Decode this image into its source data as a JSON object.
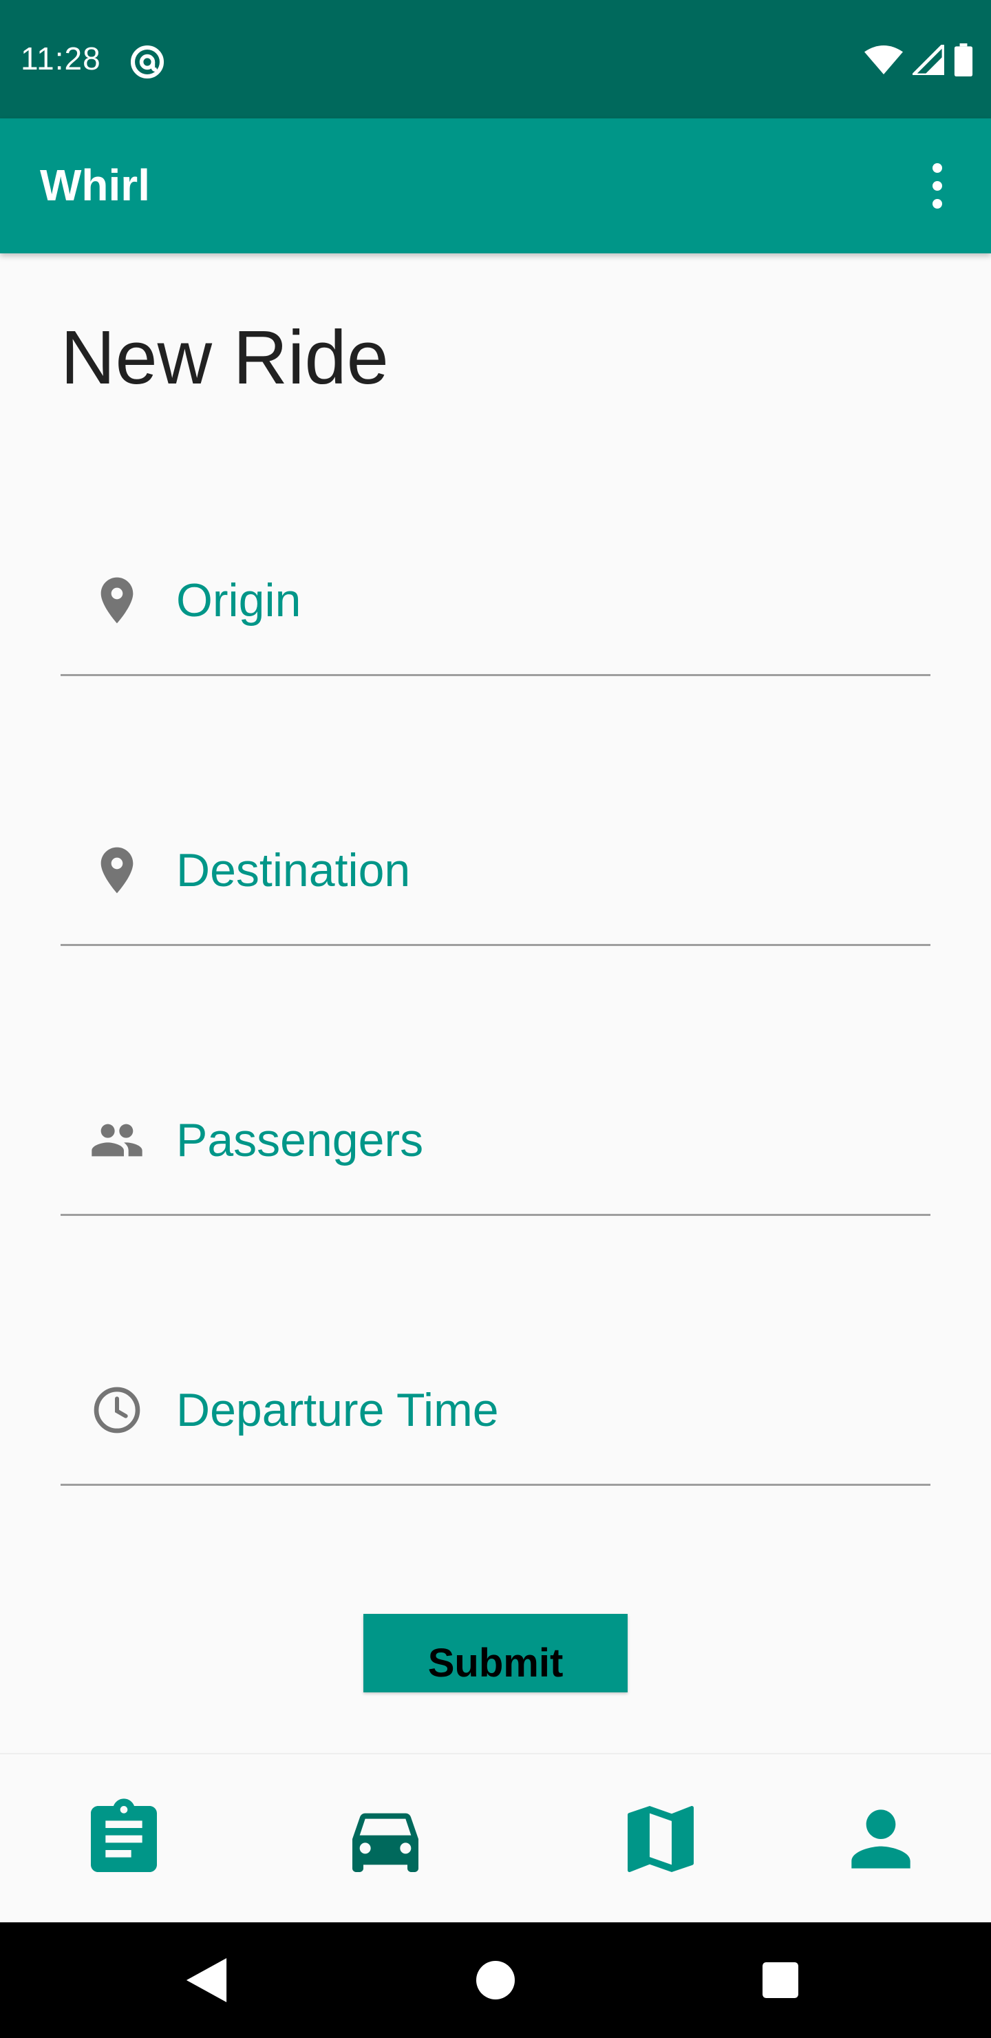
{
  "status_bar": {
    "time": "11:28",
    "icons": [
      "at-sign-icon",
      "wifi-icon",
      "signal-icon",
      "battery-icon"
    ]
  },
  "app_bar": {
    "title": "Whirl",
    "overflow_icon": "more-vert-icon"
  },
  "form": {
    "title": "New Ride",
    "fields": [
      {
        "placeholder": "Origin",
        "icon": "location-pin-icon"
      },
      {
        "placeholder": "Destination",
        "icon": "location-pin-icon"
      },
      {
        "placeholder": "Passengers",
        "icon": "people-icon"
      },
      {
        "placeholder": "Departure Time",
        "icon": "clock-icon"
      }
    ],
    "submit_label": "Submit"
  },
  "bottom_nav": {
    "items": [
      {
        "icon": "clipboard-icon",
        "selected": false
      },
      {
        "icon": "car-icon",
        "selected": true
      },
      {
        "icon": "map-icon",
        "selected": false
      },
      {
        "icon": "person-icon",
        "selected": false
      }
    ]
  },
  "system_nav": [
    "back-icon",
    "home-icon",
    "recents-icon"
  ],
  "colors": {
    "status_bar": "#00695c",
    "app_bar": "#009688",
    "accent": "#009688",
    "nav_selected": "#00695c",
    "background": "#fafafa",
    "icon_gray": "#757575"
  }
}
